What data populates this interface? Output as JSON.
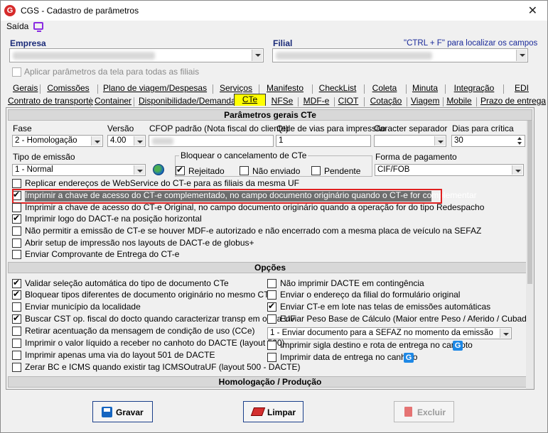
{
  "window": {
    "title": "CGS - Cadastro de parâmetros",
    "close": "✕",
    "logo": "G"
  },
  "menu": {
    "saida": "Saída"
  },
  "header": {
    "empresa_label": "Empresa",
    "filial_label": "Filial",
    "hint": "\"CTRL + F\" para localizar os campos",
    "apply_all": "Aplicar parâmetros da tela para todas as filiais"
  },
  "tabs_row1": [
    "Gerais",
    "Comissões",
    "Plano de viagem/Despesas",
    "Serviços",
    "Manifesto",
    "CheckList",
    "Coleta",
    "Minuta",
    "Integração",
    "EDI"
  ],
  "tabs_row2": [
    "Contrato de transporte",
    "Container",
    "Disponibilidade/Demanda",
    "CTe",
    "NFSe",
    "MDF-e",
    "CIOT",
    "Cotação",
    "Viagem",
    "Mobile",
    "Prazo de entrega"
  ],
  "sections": {
    "geral": "Parâmetros gerais CTe",
    "opcoes": "Opções",
    "homolog": "Homologação / Produção"
  },
  "fields": {
    "fase_label": "Fase",
    "fase_value": "2 - Homologação",
    "versao_label": "Versão",
    "versao_value": "4.00",
    "cfop_label": "CFOP padrão (Nota fiscal do cliente)",
    "vias_label": "Qtde de vias para impressão",
    "vias_value": "1",
    "separador_label": "Caracter separador",
    "dias_label": "Dias para crítica",
    "dias_value": "30",
    "emissao_label": "Tipo de emissão",
    "emissao_value": "1 - Normal",
    "bloquear_label": "Bloquear o cancelamento de CTe",
    "rejeitado": "Rejeitado",
    "nao_enviado": "Não enviado",
    "pendente": "Pendente",
    "pagamento_label": "Forma de pagamento",
    "pagamento_value": "CIF/FOB"
  },
  "general_checks": [
    {
      "label": "Replicar endereços de WebService do CT-e para as filiais da mesma UF",
      "checked": false
    },
    {
      "label": "Imprimir a chave de acesso do CT-e complementado, no campo documento originário quando o CT-e for complementar",
      "checked": true
    },
    {
      "label": "Imprimir a chave de acesso do CT-e Original, no campo documento originário quando a operação for do tipo Redespacho",
      "checked": false
    },
    {
      "label": "Imprimir logo do DACT-e na posição horizontal",
      "checked": true
    },
    {
      "label": "Não permitir a emissão de CT-e se houver MDF-e autorizado e não encerrado com a mesma placa de veículo na SEFAZ",
      "checked": false
    },
    {
      "label": "Abrir setup de impressão nos layouts de DACT-e de globus+",
      "checked": false
    },
    {
      "label": "Enviar Comprovante de Entrega do CT-e",
      "checked": false
    }
  ],
  "options_left": [
    {
      "label": "Validar seleção automática do tipo de documento CTe",
      "checked": true
    },
    {
      "label": "Bloquear tipos diferentes de documento originário no mesmo CTe",
      "checked": true
    },
    {
      "label": "Enviar município da localidade",
      "checked": false
    },
    {
      "label": "Buscar CST op. fiscal do docto quando caracterizar transp em outra UF",
      "checked": true
    },
    {
      "label": "Retirar acentuação da mensagem de condição de uso (CCe)",
      "checked": false
    },
    {
      "label": "Imprimir o valor líquido a receber no canhoto do DACTE (layout 500)",
      "checked": false
    },
    {
      "label": "Imprimir apenas uma via do layout 501 de DACTE",
      "checked": false
    },
    {
      "label": "Zerar BC e ICMS quando existir tag ICMSOutraUF (layout 500 - DACTE)",
      "checked": false
    }
  ],
  "options_right": [
    {
      "label": "Não imprimir DACTE em contingência",
      "checked": false
    },
    {
      "label": "Enviar o endereço da filial do formulário original",
      "checked": false
    },
    {
      "label": "Enviar CT-e em lote nas telas de emissões automáticas",
      "checked": true
    },
    {
      "label": "Enviar Peso Base de Cálculo (Maior entre Peso / Aferido / Cubado)",
      "checked": false
    }
  ],
  "envio_value": "1 - Enviar documento para a SEFAZ no momento da emissão",
  "options_right2": [
    {
      "label": "Imprimir sigla destino e rota de entrega no canhoto",
      "checked": false
    },
    {
      "label": "Imprimir data de entrega no canhoto",
      "checked": false
    }
  ],
  "buttons": {
    "gravar": "Gravar",
    "limpar": "Limpar",
    "excluir": "Excluir"
  }
}
